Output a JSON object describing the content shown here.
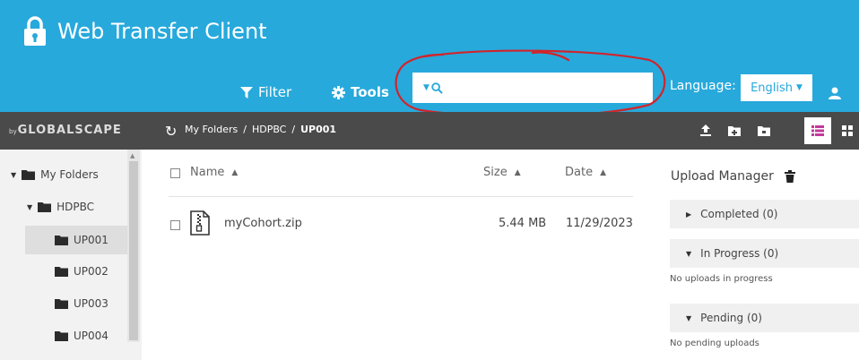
{
  "app": {
    "title": "Web Transfer Client"
  },
  "toolbar": {
    "filter_label": "Filter",
    "tools_label": "Tools",
    "search_placeholder": "",
    "language_label": "Language:",
    "language_value": "English"
  },
  "nav": {
    "brand_by": "by",
    "brand_name": "GLOBALSCAPE",
    "breadcrumb": [
      "My Folders",
      "HDPBC",
      "UP001"
    ]
  },
  "sidebar": {
    "items": [
      {
        "label": "My Folders",
        "expanded": true
      },
      {
        "label": "HDPBC",
        "expanded": true
      },
      {
        "label": "UP001",
        "selected": true
      },
      {
        "label": "UP002"
      },
      {
        "label": "UP003"
      },
      {
        "label": "UP004"
      }
    ]
  },
  "file_list": {
    "columns": [
      "Name",
      "Size",
      "Date"
    ],
    "rows": [
      {
        "name": "myCohort.zip",
        "size": "5.44 MB",
        "date": "11/29/2023"
      }
    ]
  },
  "upload_manager": {
    "title": "Upload Manager",
    "completed_label": "Completed (0)",
    "in_progress_label": "In Progress (0)",
    "in_progress_note": "No uploads in progress",
    "pending_label": "Pending (0)",
    "pending_note": "No pending uploads"
  },
  "colors": {
    "header": "#27a9dc",
    "navbar": "#4a4a4a",
    "annotation": "#d0252b",
    "accent": "#c0399b"
  }
}
